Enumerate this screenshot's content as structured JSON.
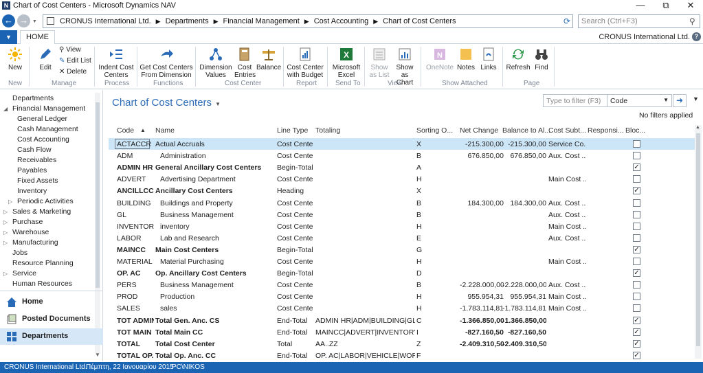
{
  "window": {
    "title": "Chart of Cost Centers - Microsoft Dynamics NAV"
  },
  "address": {
    "crumbs": [
      "CRONUS International Ltd.",
      "Departments",
      "Financial Management",
      "Cost Accounting",
      "Chart of Cost Centers"
    ],
    "search_placeholder": "Search (Ctrl+F3)"
  },
  "tabs": {
    "home": "HOME",
    "company": "CRONUS International Ltd."
  },
  "ribbon": {
    "new": {
      "label": "New",
      "group": "New"
    },
    "manage": {
      "edit": "Edit",
      "view": "View",
      "edit_list": "Edit List",
      "delete": "Delete",
      "group": "Manage"
    },
    "process": {
      "indent_l1": "Indent Cost",
      "indent_l2": "Centers",
      "group": "Process"
    },
    "functions": {
      "get_l1": "Get Cost Centers",
      "get_l2": "From Dimension",
      "group": "Functions"
    },
    "cost_center": {
      "dim_l1": "Dimension",
      "dim_l2": "Values",
      "cost_l1": "Cost",
      "cost_l2": "Entries",
      "balance": "Balance",
      "group": "Cost Center"
    },
    "report": {
      "ccb_l1": "Cost Center",
      "ccb_l2": "with Budget",
      "group": "Report"
    },
    "send_to": {
      "excel_l1": "Microsoft",
      "excel_l2": "Excel",
      "group": "Send To"
    },
    "view": {
      "sal_l1": "Show",
      "sal_l2": "as List",
      "sac_l1": "Show as",
      "sac_l2": "Chart",
      "group": "View"
    },
    "show_attached": {
      "onenote": "OneNote",
      "notes": "Notes",
      "links": "Links",
      "group": "Show Attached"
    },
    "page": {
      "refresh": "Refresh",
      "find": "Find",
      "group": "Page"
    }
  },
  "nav": {
    "items": [
      {
        "label": "Departments",
        "indent": 0,
        "tri": ""
      },
      {
        "label": "Financial Management",
        "indent": 0,
        "tri": "open"
      },
      {
        "label": "General Ledger",
        "indent": 1,
        "tri": ""
      },
      {
        "label": "Cash Management",
        "indent": 1,
        "tri": ""
      },
      {
        "label": "Cost Accounting",
        "indent": 1,
        "tri": ""
      },
      {
        "label": "Cash Flow",
        "indent": 1,
        "tri": ""
      },
      {
        "label": "Receivables",
        "indent": 1,
        "tri": ""
      },
      {
        "label": "Payables",
        "indent": 1,
        "tri": ""
      },
      {
        "label": "Fixed Assets",
        "indent": 1,
        "tri": ""
      },
      {
        "label": "Inventory",
        "indent": 1,
        "tri": ""
      },
      {
        "label": "Periodic Activities",
        "indent": 1,
        "tri": "closed"
      },
      {
        "label": "Sales & Marketing",
        "indent": 0,
        "tri": "closed"
      },
      {
        "label": "Purchase",
        "indent": 0,
        "tri": "closed"
      },
      {
        "label": "Warehouse",
        "indent": 0,
        "tri": "closed"
      },
      {
        "label": "Manufacturing",
        "indent": 0,
        "tri": "closed"
      },
      {
        "label": "Jobs",
        "indent": 0,
        "tri": ""
      },
      {
        "label": "Resource Planning",
        "indent": 0,
        "tri": ""
      },
      {
        "label": "Service",
        "indent": 0,
        "tri": "closed"
      },
      {
        "label": "Human Resources",
        "indent": 0,
        "tri": ""
      }
    ],
    "home": "Home",
    "posted": "Posted Documents",
    "departments": "Departments"
  },
  "page": {
    "title": "Chart of Cost Centers",
    "filter_placeholder": "Type to filter (F3)",
    "filter_field": "Code",
    "no_filters": "No filters applied"
  },
  "columns": [
    "Code",
    "Name",
    "Line Type",
    "Totaling",
    "Sorting O...",
    "Net Change",
    "Balance to Al...",
    "Cost Subt...",
    "Responsi...",
    "Bloc..."
  ],
  "rows": [
    {
      "code": "ACTACCR",
      "name": "Actual Accruals",
      "indent": 0,
      "bold": false,
      "type": "Cost Center",
      "totaling": "",
      "sort": "X",
      "net": "-215.300,00",
      "bal": "-215.300,00",
      "subtype": "Service Co...",
      "resp": "",
      "blocked": false
    },
    {
      "code": "ADM",
      "name": "Administration",
      "indent": 1,
      "bold": false,
      "type": "Cost Center",
      "totaling": "",
      "sort": "B",
      "net": "676.850,00",
      "bal": "676.850,00",
      "subtype": "Aux. Cost ...",
      "resp": "",
      "blocked": false
    },
    {
      "code": "ADMIN HR",
      "name": "General Ancillary Cost Centers",
      "indent": 0,
      "bold": true,
      "type": "Begin-Total",
      "totaling": "",
      "sort": "A",
      "net": "",
      "bal": "",
      "subtype": "",
      "resp": "",
      "blocked": true
    },
    {
      "code": "ADVERT",
      "name": "Advertising Department",
      "indent": 1,
      "bold": false,
      "type": "Cost Center",
      "totaling": "",
      "sort": "H",
      "net": "",
      "bal": "",
      "subtype": "Main Cost ...",
      "resp": "",
      "blocked": false
    },
    {
      "code": "ANCILLCC",
      "name": "Ancillary Cost Centers",
      "indent": 0,
      "bold": true,
      "type": "Heading",
      "totaling": "",
      "sort": "X",
      "net": "",
      "bal": "",
      "subtype": "",
      "resp": "",
      "blocked": true
    },
    {
      "code": "BUILDING",
      "name": "Buildings and Property",
      "indent": 1,
      "bold": false,
      "type": "Cost Center",
      "totaling": "",
      "sort": "B",
      "net": "184.300,00",
      "bal": "184.300,00",
      "subtype": "Aux. Cost ...",
      "resp": "",
      "blocked": false
    },
    {
      "code": "GL",
      "name": "Business Management",
      "indent": 1,
      "bold": false,
      "type": "Cost Center",
      "totaling": "",
      "sort": "B",
      "net": "",
      "bal": "",
      "subtype": "Aux. Cost ...",
      "resp": "",
      "blocked": false
    },
    {
      "code": "INVENTORY",
      "name": "inventory",
      "indent": 1,
      "bold": false,
      "type": "Cost Center",
      "totaling": "",
      "sort": "H",
      "net": "",
      "bal": "",
      "subtype": "Main Cost ...",
      "resp": "",
      "blocked": false
    },
    {
      "code": "LABOR",
      "name": "Lab and Research",
      "indent": 1,
      "bold": false,
      "type": "Cost Center",
      "totaling": "",
      "sort": "E",
      "net": "",
      "bal": "",
      "subtype": "Aux. Cost ...",
      "resp": "",
      "blocked": false
    },
    {
      "code": "MAINCC",
      "name": "Main Cost Centers",
      "indent": 0,
      "bold": true,
      "type": "Begin-Total",
      "totaling": "",
      "sort": "G",
      "net": "",
      "bal": "",
      "subtype": "",
      "resp": "",
      "blocked": true
    },
    {
      "code": "MATERIAL",
      "name": "Material Purchasing",
      "indent": 1,
      "bold": false,
      "type": "Cost Center",
      "totaling": "",
      "sort": "H",
      "net": "",
      "bal": "",
      "subtype": "Main Cost ...",
      "resp": "",
      "blocked": false
    },
    {
      "code": "OP. AC",
      "name": "Op. Ancillary Cost Centers",
      "indent": 0,
      "bold": true,
      "type": "Begin-Total",
      "totaling": "",
      "sort": "D",
      "net": "",
      "bal": "",
      "subtype": "",
      "resp": "",
      "blocked": true
    },
    {
      "code": "PERS",
      "name": "Business Management",
      "indent": 1,
      "bold": false,
      "type": "Cost Center",
      "totaling": "",
      "sort": "B",
      "net": "-2.228.000,00",
      "bal": "-2.228.000,00",
      "subtype": "Aux. Cost ...",
      "resp": "",
      "blocked": false
    },
    {
      "code": "PROD",
      "name": "Production",
      "indent": 1,
      "bold": false,
      "type": "Cost Center",
      "totaling": "",
      "sort": "H",
      "net": "955.954,31",
      "bal": "955.954,31",
      "subtype": "Main Cost ...",
      "resp": "",
      "blocked": false
    },
    {
      "code": "SALES",
      "name": "sales",
      "indent": 1,
      "bold": false,
      "type": "Cost Center",
      "totaling": "",
      "sort": "H",
      "net": "-1.783.114,81",
      "bal": "-1.783.114,81",
      "subtype": "Main Cost ...",
      "resp": "",
      "blocked": false
    },
    {
      "code": "TOT ADMIN",
      "name": "Total Gen. Anc. CS",
      "indent": 0,
      "bold": true,
      "type": "End-Total",
      "totaling": "ADMIN HR|ADM|BUILDING|GL|PE...",
      "sort": "C",
      "net": "-1.366.850,00",
      "bal": "-1.366.850,00",
      "subtype": "",
      "resp": "",
      "blocked": true
    },
    {
      "code": "TOT MAIN",
      "name": "Total Main CC",
      "indent": 0,
      "bold": true,
      "type": "End-Total",
      "totaling": "MAINCC|ADVERT|INVENTORY|M...",
      "sort": "I",
      "net": "-827.160,50",
      "bal": "-827.160,50",
      "subtype": "",
      "resp": "",
      "blocked": true
    },
    {
      "code": "TOTAL",
      "name": "Total Cost Center",
      "indent": 0,
      "bold": true,
      "type": "Total",
      "totaling": "AA..ZZ",
      "sort": "Z",
      "net": "-2.409.310,50",
      "bal": "-2.409.310,50",
      "subtype": "",
      "resp": "",
      "blocked": true
    },
    {
      "code": "TOTAL OP.",
      "name": "Total Op. Anc. CC",
      "indent": 0,
      "bold": true,
      "type": "End-Total",
      "totaling": "OP. AC|LABOR|VEHICLE|WORKSH...",
      "sort": "F",
      "net": "",
      "bal": "",
      "subtype": "",
      "resp": "",
      "blocked": true
    }
  ],
  "status": {
    "company": "CRONUS International Ltd.",
    "date": "Πέμπτη, 22 Ιανουαρίου 2015",
    "user": "PC\\NIKOS"
  }
}
